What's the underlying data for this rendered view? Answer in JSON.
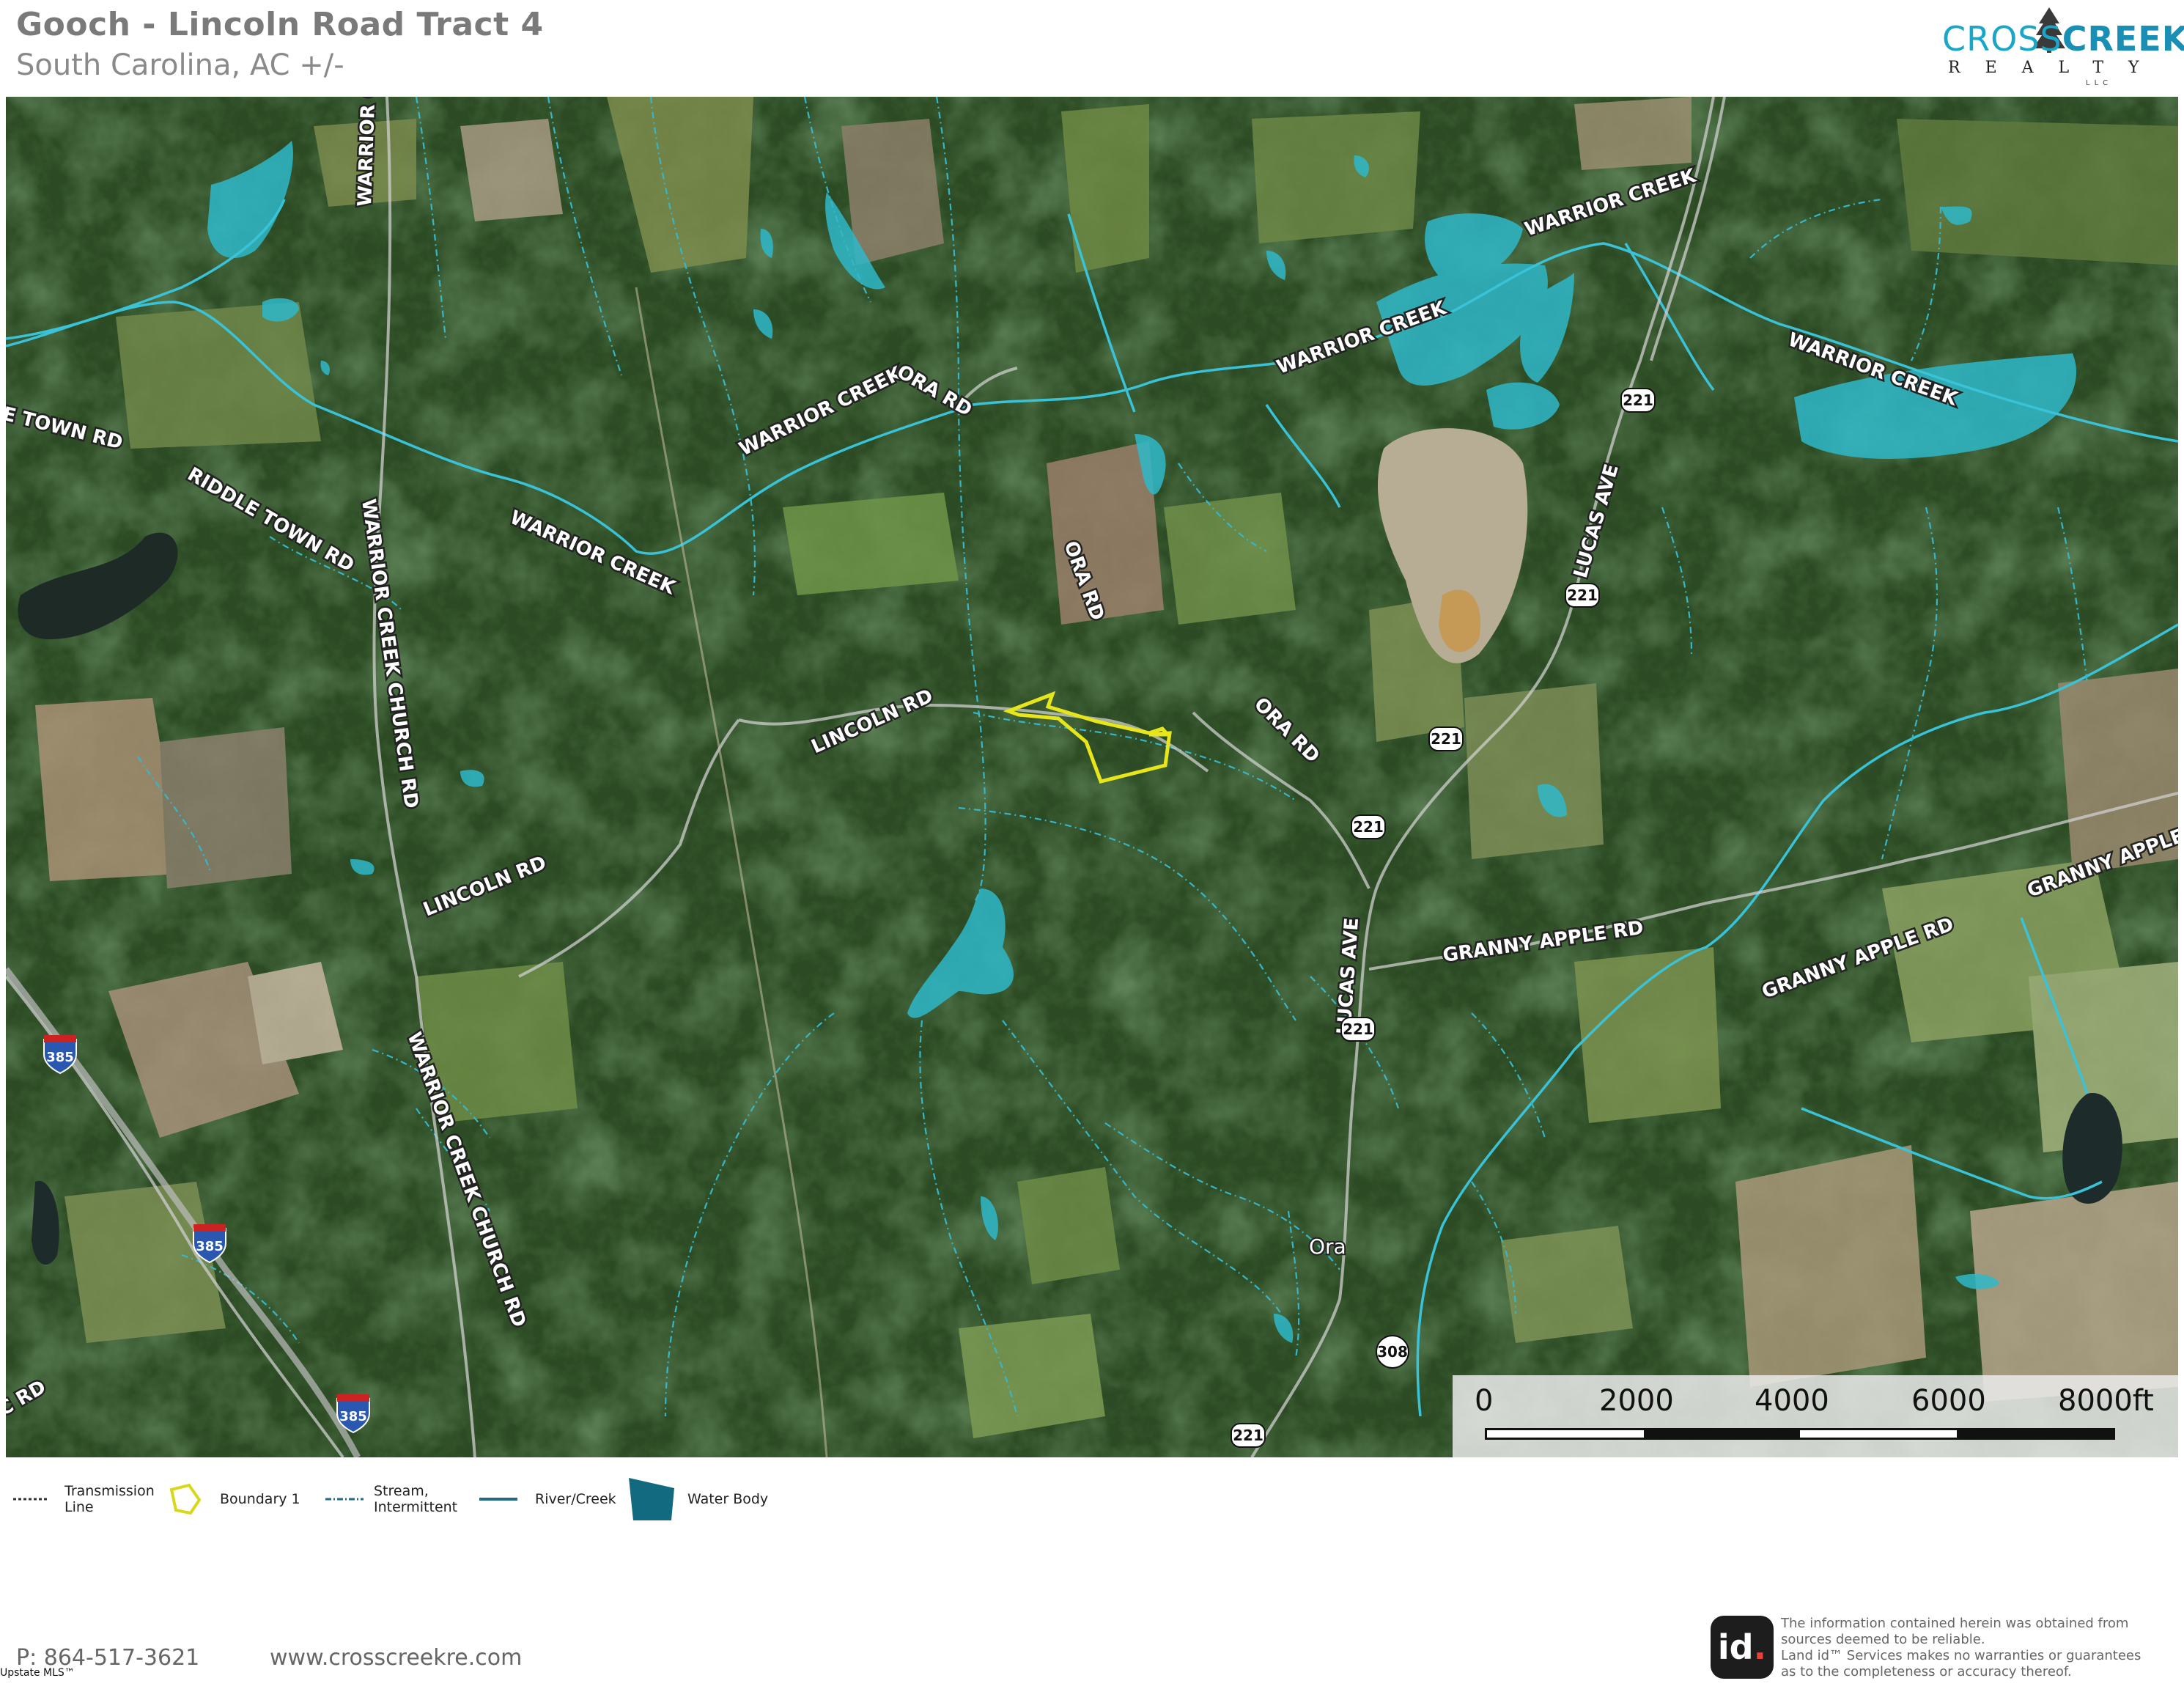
{
  "header": {
    "title": "Gooch - Lincoln Road Tract 4",
    "subtitle": "South Carolina,  AC +/-"
  },
  "brand": {
    "line1_a": "CROSS",
    "line1_b": "CREEK",
    "line2": "REALTY",
    "line3": "LLC",
    "color": "#1aa6c9"
  },
  "map": {
    "road_labels": [
      "WARRIOR CR",
      "E TOWN RD",
      "RIDDLE TOWN RD",
      "WARRIOR CREEK CHURCH RD",
      "WARRIOR CREEK",
      "WARRIOR CREEK",
      "ORA RD",
      "WARRIOR CREEK",
      "WARRIOR CREEK",
      "WARRIOR CREEK",
      "ORA RD",
      "LINCOLN RD",
      "ORA RD",
      "LINCOLN RD",
      "LUCAS AVE",
      "LUCAS AVE",
      "GRANNY APPLE RD",
      "GRANNY APPLE RD",
      "GRANNY APPLE RD",
      "WARRIOR CREEK CHURCH RD",
      "C RD"
    ],
    "route_shields": [
      "221",
      "221",
      "221",
      "221",
      "221",
      "221",
      "308"
    ],
    "interstate_shields": [
      "385",
      "385",
      "385"
    ],
    "town": "Ora",
    "boundary_color": "#e6e61a",
    "water_color": "#2fb8c9",
    "stream_color": "#3fc4d6"
  },
  "scale": {
    "ticks": [
      "0",
      "2000",
      "4000",
      "6000",
      "8000ft"
    ]
  },
  "legend": [
    {
      "label": "Transmission\nLine",
      "icon": "transmission-line-icon"
    },
    {
      "label": "Boundary 1",
      "icon": "boundary-icon"
    },
    {
      "label": "Stream,\nIntermittent",
      "icon": "stream-intermittent-icon"
    },
    {
      "label": "River/Creek",
      "icon": "river-creek-icon"
    },
    {
      "label": "Water Body",
      "icon": "water-body-icon"
    }
  ],
  "footer": {
    "phone": "P: 864-517-3621",
    "website": "www.crosscreekre.com",
    "mls": "Upstate MLS™",
    "id_logo": "id",
    "disclaimer": "The information contained herein was obtained from\nsources deemed to be reliable.\n Land id™ Services makes no warranties or guarantees\nas to the completeness or accuracy thereof."
  }
}
